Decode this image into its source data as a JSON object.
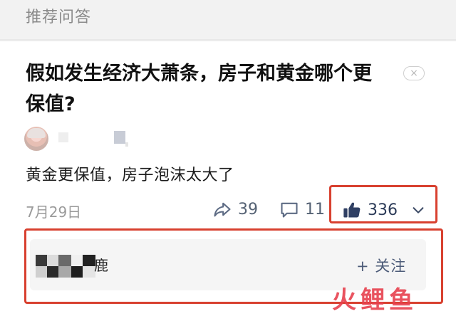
{
  "section": {
    "title": "推荐问答"
  },
  "question": {
    "title_line1": "假如发生经济大萧条，房子和黄金哪个更",
    "title_line2": "保值?"
  },
  "answer": {
    "text": "黄金更保值，房子泡沫太大了",
    "date": "7月29日"
  },
  "stats": {
    "shares": "39",
    "comments": "11",
    "likes": "336"
  },
  "follow": {
    "name_suffix": "鹿",
    "button": "+ 关注"
  },
  "watermark": "火鲤鱼",
  "icons": {
    "share": "share-icon",
    "comment": "comment-icon",
    "like": "thumbs-up-icon",
    "chevron": "chevron-down-icon",
    "dismiss": "close-icon"
  },
  "colors": {
    "accent_red": "#d8402f",
    "icon_blue_gray": "#5d6b84",
    "like_blue": "#2c3b58"
  }
}
